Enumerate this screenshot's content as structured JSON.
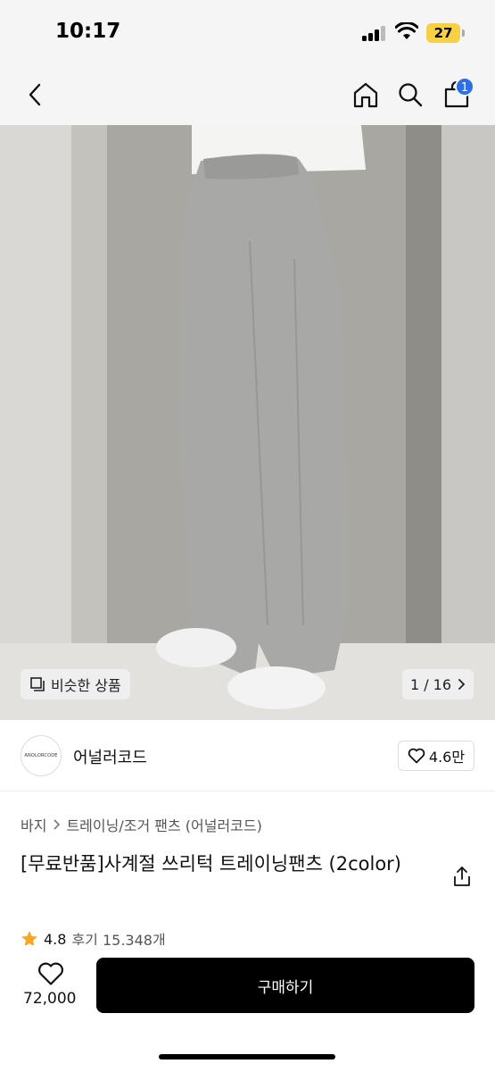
{
  "status_bar": {
    "time": "10:17",
    "battery": "27"
  },
  "nav": {
    "cart_count": "1"
  },
  "gallery": {
    "similar_label": "비슷한 상품",
    "pager": "1 / 16"
  },
  "brand": {
    "logo_text": "ANOLORCODE",
    "name": "어널러코드",
    "likes": "4.6만"
  },
  "breadcrumb": [
    "바지",
    "트레이닝/조거 팬츠 (어널러코드)"
  ],
  "product": {
    "title": "[무료반품]사계절 쓰리턱 트레이닝팬츠 (2color)",
    "rating": "4.8",
    "reviews": "후기 15,348개"
  },
  "bottom_bar": {
    "price": "72,000",
    "buy_label": "구매하기"
  },
  "colors": {
    "badge": "#2f6fe4",
    "star": "#f5a623",
    "buy_bg": "#000000"
  },
  "icons": [
    "back-icon",
    "home-icon",
    "search-icon",
    "cart-icon",
    "similar-icon",
    "chevron-right-icon",
    "heart-icon",
    "share-icon",
    "star-icon"
  ]
}
